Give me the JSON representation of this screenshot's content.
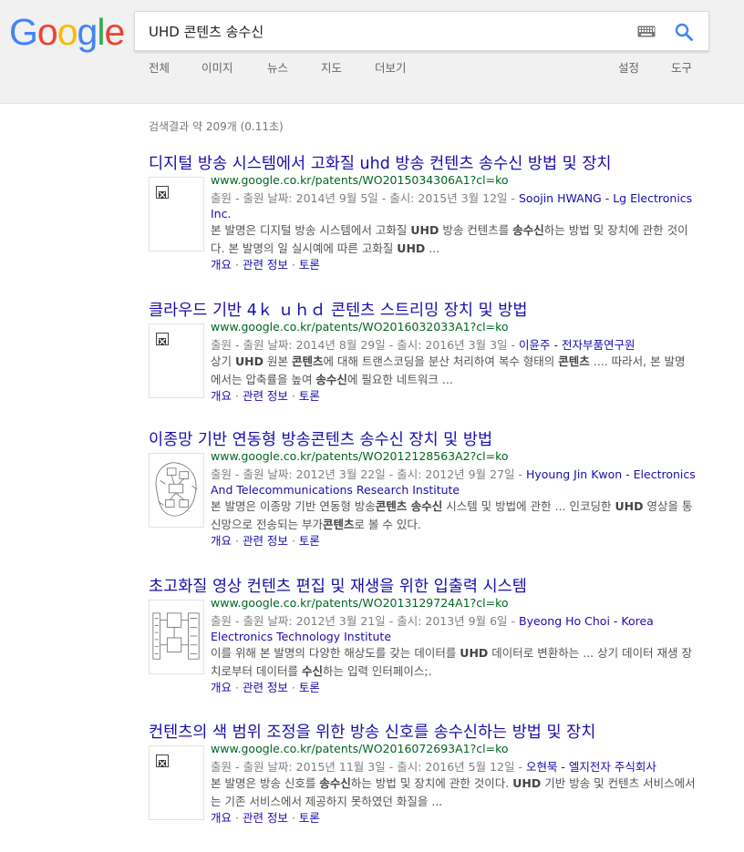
{
  "logo": {
    "letters": [
      "G",
      "o",
      "o",
      "g",
      "l",
      "e"
    ],
    "colors": [
      "#4285f4",
      "#ea4335",
      "#fbbc05",
      "#4285f4",
      "#34a853",
      "#ea4335"
    ]
  },
  "search": {
    "query": "UHD 콘텐츠 송수신"
  },
  "nav": {
    "all": "전체",
    "images": "이미지",
    "news": "뉴스",
    "maps": "지도",
    "more": "더보기",
    "settings": "설정",
    "tools": "도구"
  },
  "stats": "검색결과 약 209개 (0.11초)",
  "colors": {
    "link": "#1a0dab",
    "url": "#006621",
    "muted": "#808080"
  },
  "result_links": {
    "overview": "개요",
    "related": "관련 정보",
    "discuss": "토론",
    "sep": " · "
  },
  "results": [
    {
      "title": "디지털 방송 시스템에서 고화질 uhd 방송 컨텐츠 송수신 방법 및 장치",
      "url": "www.google.co.kr/patents/WO2015034306A1?cl=ko",
      "meta": "출원 - 출원 날짜: 2014년 9월 5일 - 출시: 2015년 3월 12일 - ",
      "author": "Soojin HWANG - Lg Electronics Inc.",
      "snippet": "본 발명은 디지털 방송 시스템에서 고화질 <b>UHD</b> 방송 컨텐츠를 <b>송수신</b>하는 방법 및 장치에 관한 것이다. 본 발명의 일 실시예에 따른 고화질 <b>UHD</b> ...",
      "thumb": "broken-image"
    },
    {
      "title": "클라우드 기반 4ｋ ｕｈｄ 콘텐츠 스트리밍 장치 및 방법",
      "url": "www.google.co.kr/patents/WO2016032033A1?cl=ko",
      "meta": "출원 - 출원 날짜: 2014년 8월 29일 - 출시: 2016년 3월 3일 - ",
      "author": "이윤주 - 전자부품연구원",
      "snippet": "상기 <b>UHD</b> 원본 <b>콘텐츠</b>에 대해 트랜스코딩을 분산 처리하여 복수 형태의 <b>콘텐츠</b> .... 따라서, 본 발명에서는 압축률을 높여 <b>송수신</b>에 필요한 네트워크 ...",
      "thumb": "broken-image"
    },
    {
      "title": "이종망 기반 연동형 방송콘텐츠 송수신 장치 및 방법",
      "url": "www.google.co.kr/patents/WO2012128563A2?cl=ko",
      "meta": "출원 - 출원 날짜: 2012년 3월 22일 - 출시: 2012년 9월 27일 - ",
      "author": "Hyoung Jin Kwon - Electronics And Telecommunications Research Institute",
      "snippet": "본 발명은 이종망 기반 연동형 방송<b>콘텐츠 송수신</b> 시스템 및 방법에 관한 ... 인코딩한 <b>UHD</b> 영상을 통신망으로 전송되는 부가<b>콘텐츠</b>로 볼 수 있다.",
      "thumb": "patent-figure"
    },
    {
      "title": "초고화질 영상 컨텐츠 편집 및 재생을 위한 입출력 시스템",
      "url": "www.google.co.kr/patents/WO2013129724A1?cl=ko",
      "meta": "출원 - 출원 날짜: 2012년 3월 21일 - 출시: 2013년 9월 6일 - ",
      "author": "Byeong Ho Choi - Korea Electronics Technology Institute",
      "snippet": "이를 위해 본 발명의 다양한 해상도를 갖는 데이터를 <b>UHD</b> 데이터로 변환하는 ... 상기 데이터 재생 장치로부터 데이터를 <b>수신</b>하는 입력 인터페이스;.",
      "thumb": "patent-diagram"
    },
    {
      "title": "컨텐츠의 색 범위 조정을 위한 방송 신호를 송수신하는 방법 및 장치",
      "url": "www.google.co.kr/patents/WO2016072693A1?cl=ko",
      "meta": "출원 - 출원 날짜: 2015년 11월 3일 - 출시: 2016년 5월 12일 - ",
      "author": "오현묵 - 엘지전자 주식회사",
      "snippet": "본 발명은 방송 신호를 <b>송수신</b>하는 방법 및 장치에 관한 것이다. <b>UHD</b> 기반 방송 및 컨텐츠 서비스에서는 기존 서비스에서 제공하지 못하였던 화질을 ...",
      "thumb": "broken-image"
    }
  ]
}
